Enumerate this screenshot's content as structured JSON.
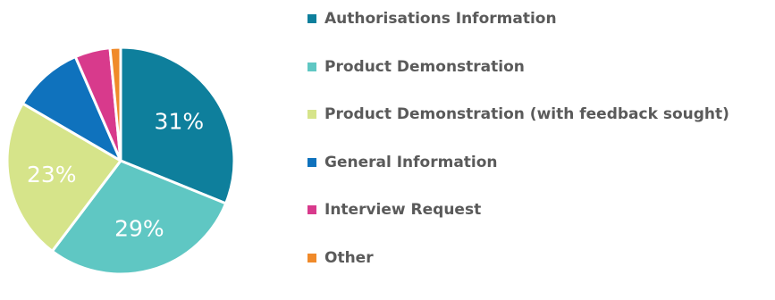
{
  "chart_data": {
    "type": "pie",
    "categories": [
      "Authorisations Information",
      "Product Demonstration",
      "Product Demonstration (with feedback sought)",
      "General Information",
      "Interview Request",
      "Other"
    ],
    "values": [
      31,
      29,
      23,
      10,
      5,
      1.5
    ],
    "data_labels": [
      "31%",
      "29%",
      "23%",
      "",
      "",
      ""
    ],
    "colors": [
      "#0e7f9c",
      "#5fc7c3",
      "#d6e48a",
      "#0f72bd",
      "#d83a8c",
      "#f08a2a"
    ],
    "legend_position": "right",
    "start_angle_deg": 0,
    "direction": "clockwise"
  }
}
